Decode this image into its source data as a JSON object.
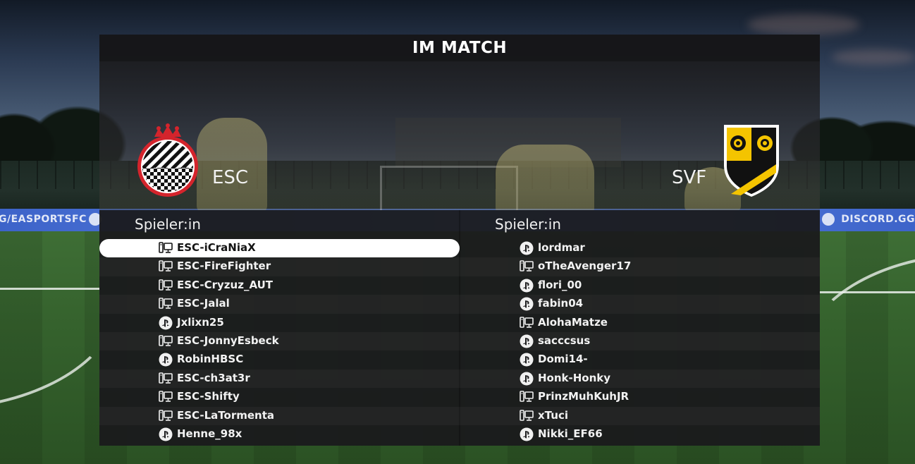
{
  "screen": {
    "title": "IM MATCH"
  },
  "background": {
    "ad_left": "G/EASPORTSFC",
    "ad_right": "DISCORD.GG"
  },
  "teams": {
    "home": {
      "name": "ESC",
      "crest": "esc-crest-icon",
      "colors": [
        "#d4242c",
        "#ffffff",
        "#111111"
      ]
    },
    "away": {
      "name": "SVF",
      "crest": "svf-crest-icon",
      "colors": [
        "#f4c400",
        "#111111"
      ]
    }
  },
  "lists": {
    "home": {
      "header": "Spieler:in",
      "players": [
        {
          "name": "ESC-iCraNiaX",
          "platform": "pc-icon",
          "selected": true
        },
        {
          "name": "ESC-FireFighter",
          "platform": "pc-icon"
        },
        {
          "name": "ESC-Cryzuz_AUT",
          "platform": "pc-icon"
        },
        {
          "name": "ESC-Jalal",
          "platform": "pc-icon"
        },
        {
          "name": "Jxlixn25",
          "platform": "playstation-icon"
        },
        {
          "name": "ESC-JonnyEsbeck",
          "platform": "pc-icon"
        },
        {
          "name": "RobinHBSC",
          "platform": "playstation-icon"
        },
        {
          "name": "ESC-ch3at3r",
          "platform": "pc-icon"
        },
        {
          "name": "ESC-Shifty",
          "platform": "pc-icon"
        },
        {
          "name": "ESC-LaTormenta",
          "platform": "pc-icon"
        },
        {
          "name": "Henne_98x",
          "platform": "playstation-icon"
        }
      ]
    },
    "away": {
      "header": "Spieler:in",
      "players": [
        {
          "name": "lordmar",
          "platform": "playstation-icon"
        },
        {
          "name": "oTheAvenger17",
          "platform": "pc-icon"
        },
        {
          "name": "flori_00",
          "platform": "playstation-icon"
        },
        {
          "name": "fabin04",
          "platform": "playstation-icon"
        },
        {
          "name": "AlohaMatze",
          "platform": "pc-icon"
        },
        {
          "name": "sacccsus",
          "platform": "playstation-icon"
        },
        {
          "name": "Domi14-",
          "platform": "playstation-icon"
        },
        {
          "name": "Honk-Honky",
          "platform": "playstation-icon"
        },
        {
          "name": "PrinzMuhKuhJR",
          "platform": "pc-icon"
        },
        {
          "name": "xTuci",
          "platform": "pc-icon"
        },
        {
          "name": "Nikki_EF66",
          "platform": "playstation-icon"
        }
      ]
    }
  }
}
